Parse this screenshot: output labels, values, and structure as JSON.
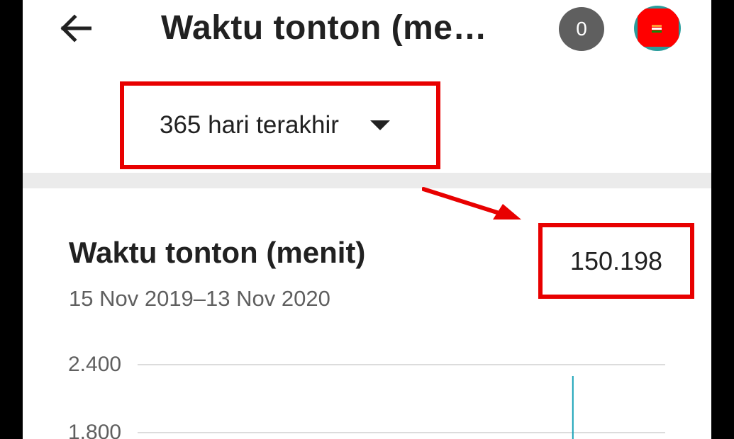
{
  "header": {
    "back_icon": "arrow-back-icon",
    "title": "Waktu tonton (me…",
    "notification_count": "0",
    "avatar_icon": "channel-avatar-icon"
  },
  "filter": {
    "selected_range": "365 hari terakhir",
    "caret_icon": "dropdown-caret-icon"
  },
  "metric": {
    "title": "Waktu tonton (menit)",
    "date_range": "15 Nov 2019–13 Nov 2020",
    "value": "150.198"
  },
  "annotation": {
    "color": "#e80000",
    "arrow_icon": "red-annotation-arrow-icon"
  },
  "chart_data": {
    "type": "line",
    "y_tick_labels": [
      "2.400",
      "1.800"
    ],
    "y_ticks": [
      2400,
      1800
    ],
    "line_color": "#1aa3b8",
    "visible_peak_x_fraction": 0.825,
    "visible_peak_value": 2300,
    "grid": true
  },
  "colors": {
    "background": "#ffffff",
    "text_primary": "#212121",
    "text_secondary": "#5f5f5f",
    "accent": "#1aa3b8"
  }
}
